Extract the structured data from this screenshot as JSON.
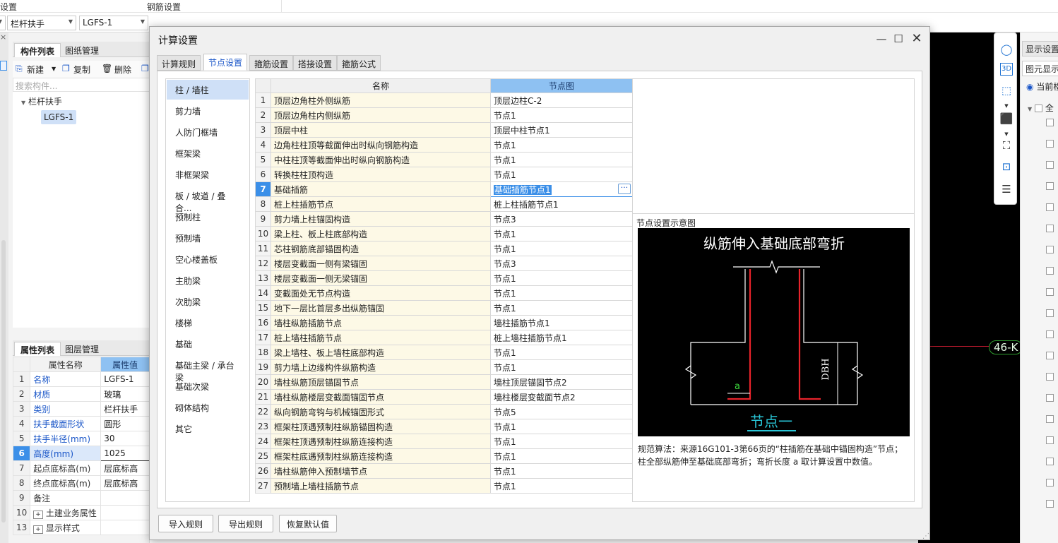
{
  "ribbon": {
    "label_left": "设置",
    "label_rebar": "钢筋设置"
  },
  "toolbar": {
    "combo1": "栏杆扶手",
    "combo2": "LGFS-1"
  },
  "component_panel": {
    "tabs": [
      "构件列表",
      "图纸管理"
    ],
    "actions": {
      "new": "新建",
      "copy": "复制",
      "delete": "删除"
    },
    "search_placeholder": "搜索构件...",
    "tree_root": "栏杆扶手",
    "tree_child": "LGFS-1"
  },
  "property_panel": {
    "tabs": [
      "属性列表",
      "图层管理"
    ],
    "col_name": "属性名称",
    "col_value": "属性值",
    "rows": [
      {
        "n": "1",
        "k": "名称",
        "v": "LGFS-1"
      },
      {
        "n": "2",
        "k": "材质",
        "v": "玻璃"
      },
      {
        "n": "3",
        "k": "类别",
        "v": "栏杆扶手"
      },
      {
        "n": "4",
        "k": "扶手截面形状",
        "v": "圆形"
      },
      {
        "n": "5",
        "k": "扶手半径(mm)",
        "v": "30"
      },
      {
        "n": "6",
        "k": "高度(mm)",
        "v": "1025"
      },
      {
        "n": "7",
        "k": "起点底标高(m)",
        "v": "层底标高"
      },
      {
        "n": "8",
        "k": "终点底标高(m)",
        "v": "层底标高"
      },
      {
        "n": "9",
        "k": "备注",
        "v": ""
      },
      {
        "n": "10",
        "k": "土建业务属性",
        "v": ""
      },
      {
        "n": "13",
        "k": "显示样式",
        "v": ""
      }
    ]
  },
  "canvas": {
    "axis_label": "46-K"
  },
  "right_panel": {
    "tab1": "显示设置",
    "tab2": "图元显示",
    "radio_label": "当前楼",
    "tree_label": "全"
  },
  "dialog": {
    "title": "计算设置",
    "tabs": [
      "计算规则",
      "节点设置",
      "箍筋设置",
      "搭接设置",
      "箍筋公式"
    ],
    "categories": [
      "柱 / 墙柱",
      "剪力墙",
      "人防门框墙",
      "框架梁",
      "非框架梁",
      "板 / 坡道 / 叠合...",
      "预制柱",
      "预制墙",
      "空心楼盖板",
      "主肋梁",
      "次肋梁",
      "楼梯",
      "基础",
      "基础主梁 / 承台梁",
      "基础次梁",
      "砌体结构",
      "其它"
    ],
    "grid_headers": {
      "name": "名称",
      "node": "节点图"
    },
    "grid_rows": [
      {
        "i": "1",
        "name": "顶层边角柱外侧纵筋",
        "node": "顶层边柱C-2"
      },
      {
        "i": "2",
        "name": "顶层边角柱内侧纵筋",
        "node": "节点1"
      },
      {
        "i": "3",
        "name": "顶层中柱",
        "node": "顶层中柱节点1"
      },
      {
        "i": "4",
        "name": "边角柱柱顶等截面伸出时纵向钢筋构造",
        "node": "节点1"
      },
      {
        "i": "5",
        "name": "中柱柱顶等截面伸出时纵向钢筋构造",
        "node": "节点1"
      },
      {
        "i": "6",
        "name": "转换柱柱顶构造",
        "node": "节点1"
      },
      {
        "i": "7",
        "name": "基础插筋",
        "node": "基础插筋节点1"
      },
      {
        "i": "8",
        "name": "桩上柱插筋节点",
        "node": "桩上柱插筋节点1"
      },
      {
        "i": "9",
        "name": "剪力墙上柱锚固构造",
        "node": "节点3"
      },
      {
        "i": "10",
        "name": "梁上柱、板上柱底部构造",
        "node": "节点1"
      },
      {
        "i": "11",
        "name": "芯柱钢筋底部锚固构造",
        "node": "节点1"
      },
      {
        "i": "12",
        "name": "楼层变截面一侧有梁锚固",
        "node": "节点3"
      },
      {
        "i": "13",
        "name": "楼层变截面一侧无梁锚固",
        "node": "节点1"
      },
      {
        "i": "14",
        "name": "变截面处无节点构造",
        "node": "节点1"
      },
      {
        "i": "15",
        "name": "地下一层比首层多出纵筋锚固",
        "node": "节点1"
      },
      {
        "i": "16",
        "name": "墙柱纵筋插筋节点",
        "node": "墙柱插筋节点1"
      },
      {
        "i": "17",
        "name": "桩上墙柱插筋节点",
        "node": "桩上墙柱插筋节点1"
      },
      {
        "i": "18",
        "name": "梁上墙柱、板上墙柱底部构造",
        "node": "节点1"
      },
      {
        "i": "19",
        "name": "剪力墙上边缘构件纵筋构造",
        "node": "节点1"
      },
      {
        "i": "20",
        "name": "墙柱纵筋顶层锚固节点",
        "node": "墙柱顶层锚固节点2"
      },
      {
        "i": "21",
        "name": "墙柱纵筋楼层变截面锚固节点",
        "node": "墙柱楼层变截面节点2"
      },
      {
        "i": "22",
        "name": "纵向钢筋弯钩与机械锚固形式",
        "node": "节点5"
      },
      {
        "i": "23",
        "name": "框架柱顶遇预制柱纵筋锚固构造",
        "node": "节点1"
      },
      {
        "i": "24",
        "name": "框架柱顶遇预制柱纵筋连接构造",
        "node": "节点1"
      },
      {
        "i": "25",
        "name": "框架柱底遇预制柱纵筋连接构造",
        "node": "节点1"
      },
      {
        "i": "26",
        "name": "墙柱纵筋伸入预制墙节点",
        "node": "节点1"
      },
      {
        "i": "27",
        "name": "预制墙上墙柱插筋节点",
        "node": "节点1"
      }
    ],
    "preview_label": "节点设置示意图",
    "diagram": {
      "title": "纵筋伸入基础底部弯折",
      "dim_label": "DBH",
      "a_label": "a",
      "caption": "节点一"
    },
    "rule_line1": "规范算法：来源16G101-3第66页的“柱插筋在基础中锚固构造”节点；",
    "rule_line2": "柱全部纵筋伸至基础底部弯折；弯折长度 a 取计算设置中数值。",
    "buttons": {
      "import": "导入规则",
      "export": "导出规则",
      "restore": "恢复默认值"
    }
  }
}
